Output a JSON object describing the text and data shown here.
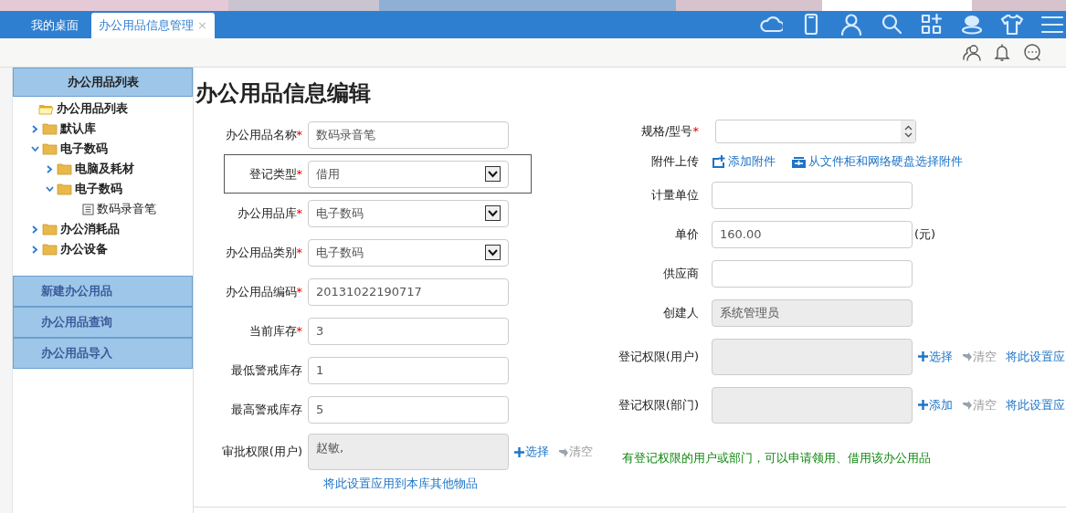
{
  "tabs": [
    {
      "label": "我的桌面",
      "selected": false,
      "closable": false
    },
    {
      "label": "办公用品信息管理",
      "selected": true,
      "closable": true,
      "close": "×"
    }
  ],
  "sidebar": {
    "title": "办公用品列表",
    "tree": [
      {
        "label": "办公用品列表",
        "kind": "root",
        "expanded": true,
        "children": [
          {
            "label": "默认库",
            "kind": "folder",
            "expanded": false
          },
          {
            "label": "电子数码",
            "kind": "folder",
            "expanded": true,
            "children": [
              {
                "label": "电脑及耗材",
                "kind": "folder",
                "expanded": false
              },
              {
                "label": "电子数码",
                "kind": "folder",
                "expanded": true,
                "children": [
                  {
                    "label": "数码录音笔",
                    "kind": "file"
                  }
                ]
              }
            ]
          },
          {
            "label": "办公消耗品",
            "kind": "folder",
            "expanded": false
          },
          {
            "label": "办公设备",
            "kind": "folder",
            "expanded": false
          }
        ]
      }
    ],
    "menu": [
      {
        "label": "新建办公用品"
      },
      {
        "label": "办公用品查询"
      },
      {
        "label": "办公用品导入"
      }
    ]
  },
  "form": {
    "title": "办公用品信息编辑",
    "left_fields": [
      {
        "label": "办公用品名称",
        "required_mark": "*",
        "kind": "text",
        "value": "数码录音笔",
        "highlighted": false
      },
      {
        "label": "登记类型",
        "required_mark": "*",
        "kind": "select",
        "value": "借用",
        "highlighted": true
      },
      {
        "label": "办公用品库",
        "required_mark": "*",
        "kind": "select",
        "value": "电子数码",
        "highlighted": false
      },
      {
        "label": "办公用品类别",
        "required_mark": "*",
        "kind": "select",
        "value": "电子数码",
        "highlighted": false
      },
      {
        "label": "办公用品编码",
        "required_mark": "*",
        "kind": "text",
        "value": "20131022190717",
        "highlighted": false
      },
      {
        "label": "当前库存",
        "required_mark": "*",
        "kind": "text",
        "value": "3",
        "highlighted": false
      },
      {
        "label": "最低警戒库存",
        "kind": "text",
        "value": "1",
        "highlighted": false
      },
      {
        "label": "最高警戒库存",
        "kind": "text",
        "value": "5",
        "highlighted": false
      },
      {
        "label": "审批权限(用户)",
        "kind": "readonly-area",
        "value": "赵敏,",
        "highlighted": false,
        "actions": [
          {
            "label": "选择",
            "kind": "add",
            "disabled": false
          },
          {
            "label": "清空",
            "kind": "clear",
            "disabled": true
          }
        ]
      }
    ],
    "left_link": "将此设置应用到本库其他物品",
    "right_fields": [
      {
        "label": "规格/型号",
        "required_mark": "*",
        "kind": "spinner"
      },
      {
        "label": "附件上传",
        "kind": "attachments",
        "links": [
          {
            "label": "添加附件",
            "kind": "upload"
          },
          {
            "label": "从文件柜和网络硬盘选择附件",
            "kind": "cabinet"
          }
        ]
      },
      {
        "label": "计量单位",
        "kind": "text"
      },
      {
        "label": "单价",
        "kind": "text",
        "value": "160.00",
        "suffix": "(元)"
      },
      {
        "label": "供应商",
        "kind": "text"
      },
      {
        "label": "创建人",
        "kind": "readonly",
        "value": "系统管理员"
      },
      {
        "label": "登记权限(用户)",
        "kind": "readonly-area",
        "actions": [
          {
            "label": "选择",
            "kind": "add",
            "disabled": false
          },
          {
            "label": "清空",
            "kind": "clear",
            "disabled": true
          },
          {
            "label": "将此设置应",
            "kind": "link",
            "disabled": false
          }
        ]
      },
      {
        "label": "登记权限(部门)",
        "kind": "readonly-area",
        "actions": [
          {
            "label": "添加",
            "kind": "add",
            "disabled": false
          },
          {
            "label": "清空",
            "kind": "clear",
            "disabled": true
          },
          {
            "label": "将此设置应",
            "kind": "link",
            "disabled": false
          }
        ]
      }
    ],
    "note": "有登记权限的用户或部门，可以申请领用、借用该办公用品"
  }
}
